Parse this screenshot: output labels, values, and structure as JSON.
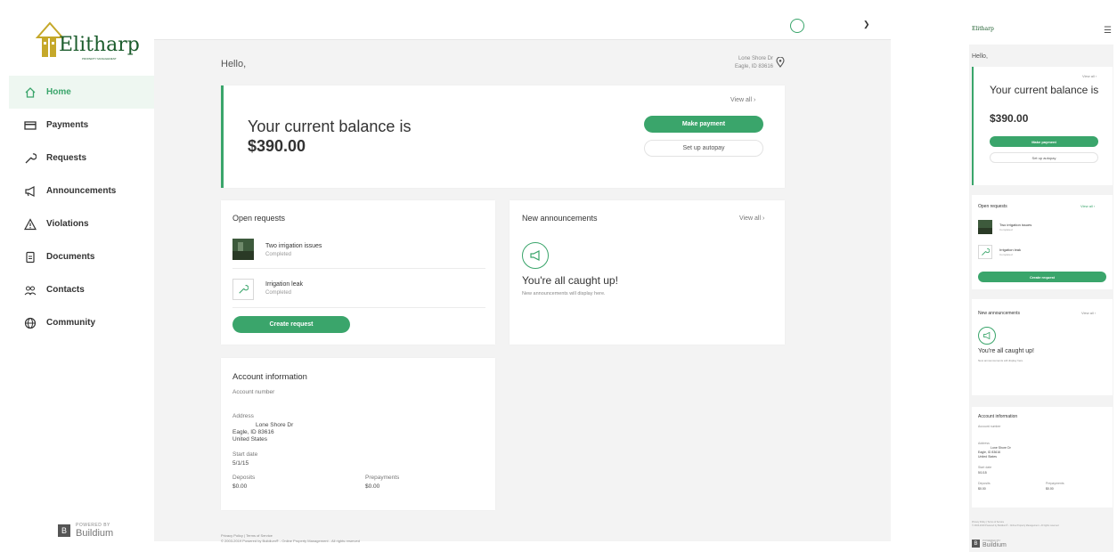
{
  "brand": {
    "name": "Elitharp",
    "sub": "PROPERTY MANAGEMENT",
    "accent": "#3aa56b"
  },
  "sidebar": {
    "items": [
      {
        "label": "Home",
        "icon": "home-icon",
        "active": true
      },
      {
        "label": "Payments",
        "icon": "credit-card-icon"
      },
      {
        "label": "Requests",
        "icon": "wrench-icon"
      },
      {
        "label": "Announcements",
        "icon": "megaphone-icon"
      },
      {
        "label": "Violations",
        "icon": "warning-icon"
      },
      {
        "label": "Documents",
        "icon": "document-icon"
      },
      {
        "label": "Contacts",
        "icon": "people-icon"
      },
      {
        "label": "Community",
        "icon": "globe-icon"
      }
    ],
    "powered_by": "POWERED BY",
    "buildium": "Buildium"
  },
  "main": {
    "hello": "Hello,",
    "location": {
      "line1": "Lone Shore Dr",
      "line2": "Eagle, ID 83616"
    },
    "balance": {
      "view_all": "View all",
      "label": "Your current balance is",
      "amount": "$390.00",
      "make_payment": "Make payment",
      "autopay": "Set up autopay"
    },
    "requests": {
      "title": "Open requests",
      "items": [
        {
          "name": "Two irrigation issues",
          "status": "Completed"
        },
        {
          "name": "Irrigation leak",
          "status": "Completed"
        }
      ],
      "create": "Create request"
    },
    "announcements": {
      "title": "New announcements",
      "view_all": "View all",
      "caught_up": "You're all caught up!",
      "sub": "New announcements will display here."
    },
    "account": {
      "title": "Account information",
      "number_label": "Account number",
      "address_label": "Address",
      "address_line1": "Lone Shore Dr",
      "address_line2": "Eagle, ID 83616",
      "address_line3": "United States",
      "start_label": "Start date",
      "start_value": "5/1/15",
      "deposits_label": "Deposits",
      "deposits_value": "$0.00",
      "prepayments_label": "Prepayments",
      "prepayments_value": "$0.00"
    },
    "footer": {
      "line1": "Privacy Policy | Terms of Service",
      "line2": "© 2003-2019 Powered by Buildium® - Online Property Management - All rights reserved"
    }
  },
  "mobile": {
    "hello": "Hello,",
    "view_all": "View all",
    "balance_label": "Your current balance is",
    "amount": "$390.00",
    "make_payment": "Make payment",
    "autopay": "Set up autopay",
    "requests_title": "Open requests",
    "req1": "Two irrigation issues",
    "req1_status": "Completed",
    "req2": "Irrigation leak",
    "req2_status": "Completed",
    "create": "Create request",
    "ann_title": "New announcements",
    "caught": "You're all caught up!",
    "caught_sub": "New announcements will display here.",
    "acc_title": "Account information",
    "acc_number": "Account number",
    "address_label": "Address",
    "address1": "Lone Shore Dr",
    "address2": "Eagle, ID 83616",
    "address3": "United States",
    "start_label": "Start date",
    "start_value": "5/1/15",
    "deposits_label": "Deposits",
    "deposits_value": "$0.00",
    "prepay_label": "Prepayments",
    "prepay_value": "$0.00",
    "footer1": "Privacy Policy | Terms of Service",
    "footer2": "© 2003-2019 Powered by Buildium® - Online Property Management - All rights reserved",
    "powered_by": "POWERED BY",
    "buildium": "Buildium"
  }
}
